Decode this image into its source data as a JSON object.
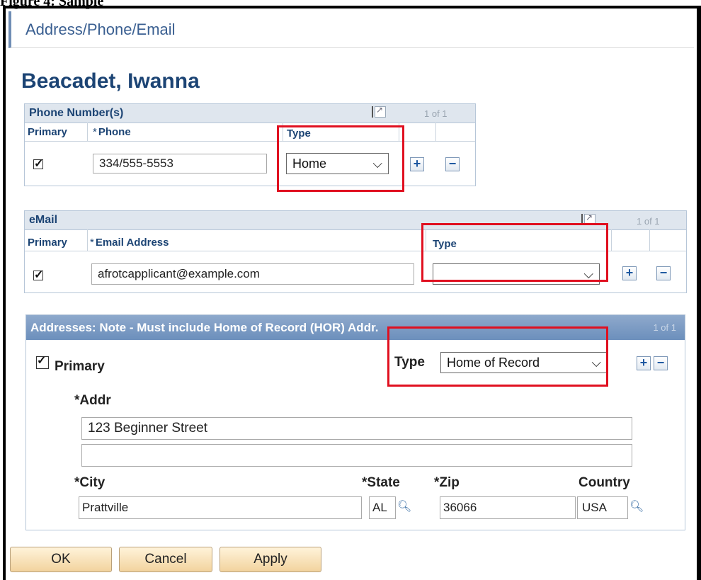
{
  "caption": "Figure 4: Sample",
  "window": {
    "title": "Address/Phone/Email"
  },
  "person": {
    "name": "Beacadet, Iwanna"
  },
  "phone": {
    "title": "Phone Number(s)",
    "count": "1 of 1",
    "columns": {
      "primary": "Primary",
      "phone": "Phone",
      "type": "Type"
    },
    "row": {
      "primary_checked": true,
      "phone": "334/555-5553",
      "type": "Home"
    }
  },
  "email": {
    "title": "eMail",
    "count": "1 of 1",
    "columns": {
      "primary": "Primary",
      "address": "Email Address",
      "type": "Type"
    },
    "row": {
      "primary_checked": true,
      "address": "afrotcapplicant@example.com",
      "type": ""
    }
  },
  "addresses": {
    "title": "Addresses: Note - Must include Home of Record (HOR) Addr.",
    "count": "1 of 1",
    "primary_label": "Primary",
    "primary_checked": true,
    "type_label": "Type",
    "type_value": "Home of Record",
    "addr_label": "Addr",
    "addr_line1": "123 Beginner Street",
    "addr_line2": "",
    "city_label": "City",
    "city": "Prattville",
    "state_label": "State",
    "state": "AL",
    "zip_label": "Zip",
    "zip": "36066",
    "country_label": "Country",
    "country": "USA"
  },
  "buttons": {
    "ok": "OK",
    "cancel": "Cancel",
    "apply": "Apply"
  },
  "required_marker": "*",
  "icons": {
    "add": "+",
    "remove": "−",
    "dropdown": "chevron-down-icon",
    "lookup": "magnifier-icon"
  },
  "colors": {
    "highlight": "#e01020",
    "header_text": "#1c4474"
  }
}
